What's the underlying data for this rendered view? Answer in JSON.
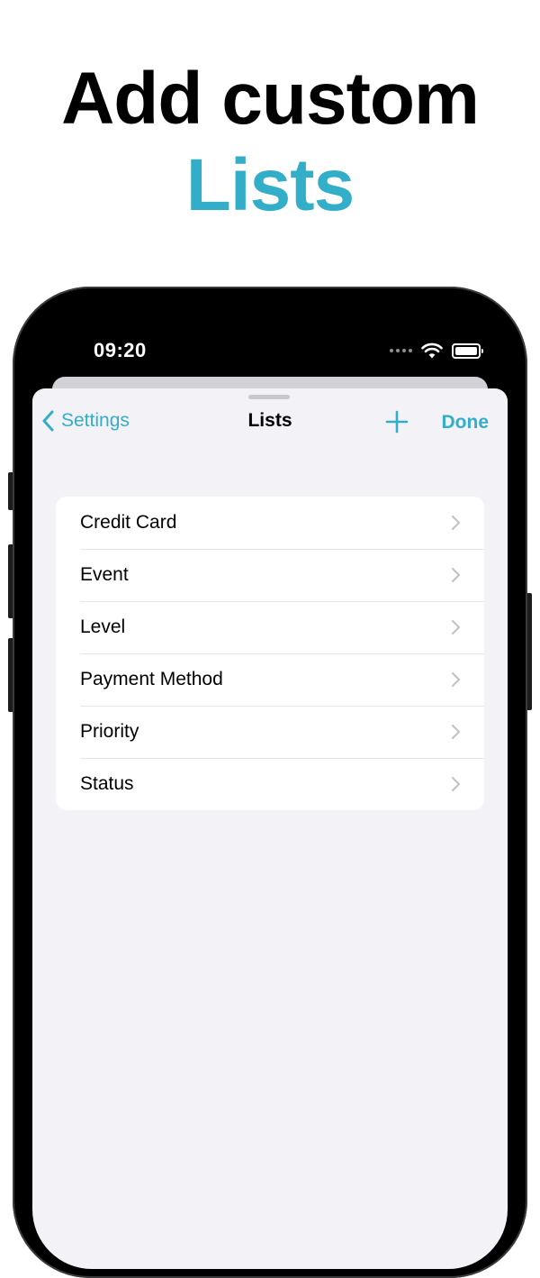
{
  "headline": {
    "line1": "Add custom",
    "line2": "Lists"
  },
  "colors": {
    "accent": "#33aec8",
    "sheet_background": "#f2f2f7"
  },
  "status_bar": {
    "time": "09:20",
    "icons": [
      "cellular-dots-icon",
      "wifi-icon",
      "battery-icon"
    ]
  },
  "nav": {
    "back_label": "Settings",
    "title": "Lists",
    "add_icon": "plus-icon",
    "done_label": "Done"
  },
  "lists": {
    "items": [
      {
        "label": "Credit Card"
      },
      {
        "label": "Event"
      },
      {
        "label": "Level"
      },
      {
        "label": "Payment Method"
      },
      {
        "label": "Priority"
      },
      {
        "label": "Status"
      }
    ]
  }
}
